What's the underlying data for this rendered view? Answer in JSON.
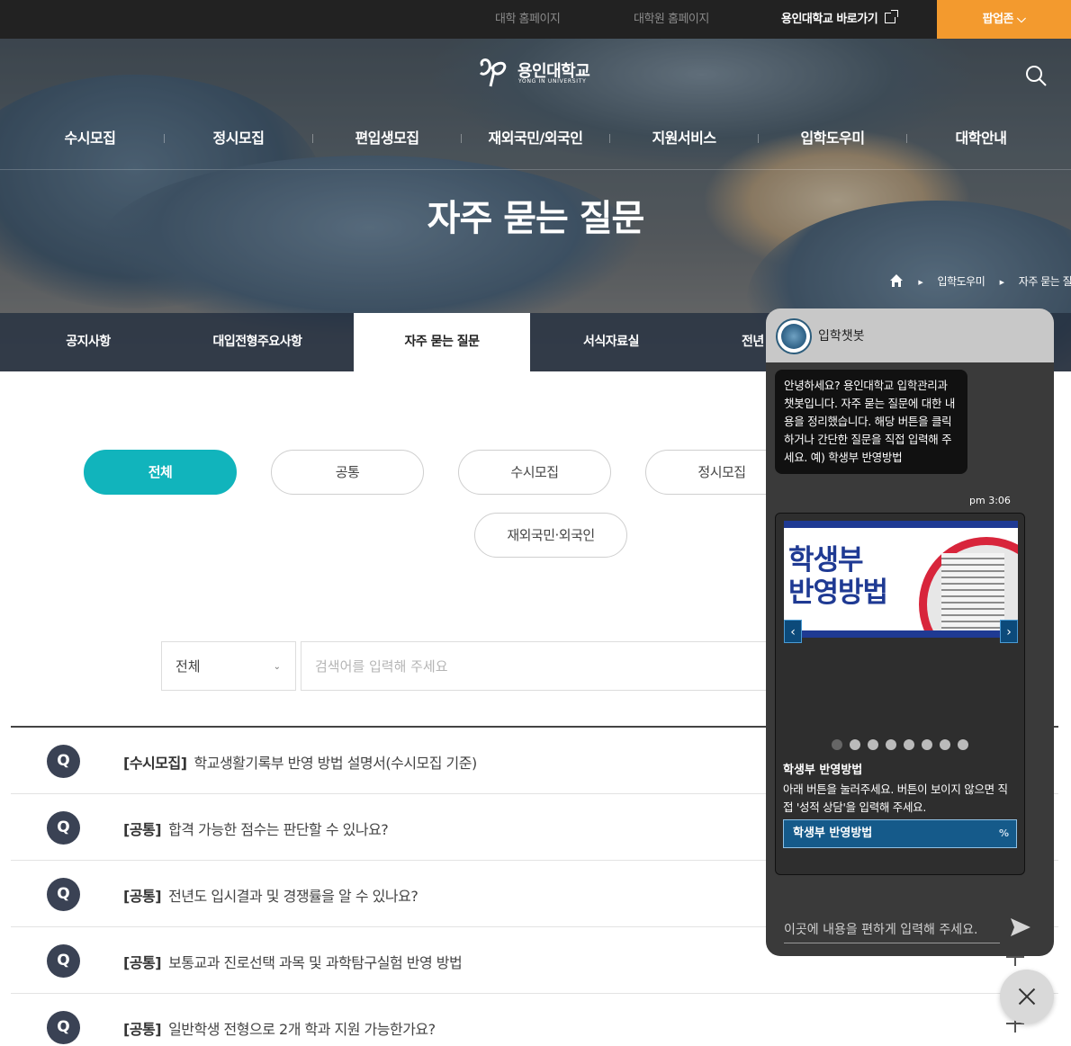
{
  "topbar": {
    "links": [
      "대학 홈페이지",
      "대학원 홈페이지",
      "용인대학교 바로가기"
    ],
    "popup_zone": "팝업존 ⌵"
  },
  "logo": {
    "name": "용인대학교",
    "sub": "YONG IN UNIVERSITY"
  },
  "gnb": [
    "수시모집",
    "정시모집",
    "편입생모집",
    "재외국민/외국인",
    "지원서비스",
    "입학도우미",
    "대학안내"
  ],
  "page_title": "자주 묻는 질문",
  "breadcrumb": [
    "입학도우미",
    "자주 묻는 질문"
  ],
  "subnav": [
    "공지사항",
    "대입전형주요사항",
    "자주 묻는 질문",
    "서식자료실",
    "전년"
  ],
  "categories": [
    "전체",
    "공통",
    "수시모집",
    "정시모집",
    "재외국민·외국인"
  ],
  "search": {
    "select_value": "전체",
    "placeholder": "검색어를 입력해 주세요"
  },
  "faq": [
    {
      "badge": "Q",
      "category": "[수시모집]",
      "question": "학교생활기록부 반영 방법 설명서(수시모집 기준)"
    },
    {
      "badge": "Q",
      "category": "[공통]",
      "question": "합격 가능한 점수는 판단할 수 있나요?"
    },
    {
      "badge": "Q",
      "category": "[공통]",
      "question": "전년도 입시결과 및 경쟁률을 알 수 있나요?"
    },
    {
      "badge": "Q",
      "category": "[공통]",
      "question": "보통교과 진로선택 과목 및 과학탐구실험 반영 방법"
    },
    {
      "badge": "Q",
      "category": "[공통]",
      "question": "일반학생 전형으로 2개 학과 지원 가능한가요?"
    }
  ],
  "chatbot": {
    "title": "입학챗봇",
    "greeting": "안녕하세요? 용인대학교 입학관리과 챗봇입니다. 자주 묻는 질문에 대한 내용을 정리했습니다. 해당 버튼을 클릭하거나 간단한 질문을 직접 입력해 주세요. 예) 학생부 반영방법",
    "time": "pm 3:06",
    "banner_line1": "학생부",
    "banner_line2": "반영방법",
    "card_title": "학생부 반영방법",
    "card_desc": "아래 버튼을 눌러주세요. 버튼이 보이지 않으면 직접 '성적 상담'을 입력해 주세요.",
    "card_button": "학생부 반영방법",
    "input_placeholder": "이곳에 내용을 편하게 입력해 주세요.",
    "carousel_total": 8,
    "carousel_active": 1
  },
  "colors": {
    "accent_teal": "#11b4bc",
    "popup_orange": "#f39a2e",
    "q_badge": "#3a4254"
  }
}
